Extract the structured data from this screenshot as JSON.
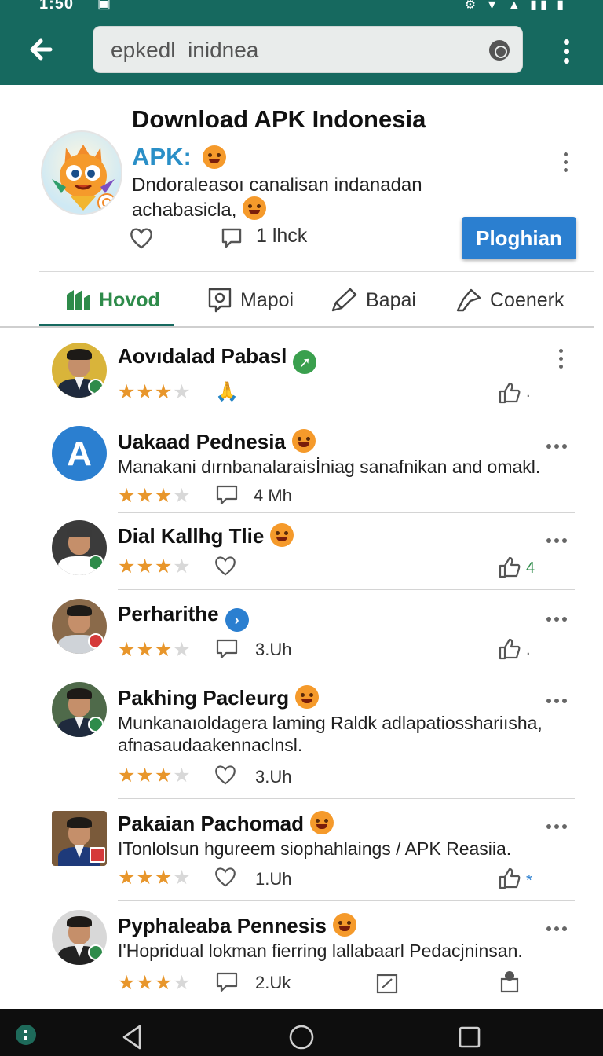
{
  "status_bar": {
    "time": "1:50",
    "notification_icon": "gallery-icon",
    "system_icons": "⚙ ▼ ▲ ▮▮ ▮"
  },
  "search": {
    "value": "epkedl  inidnea",
    "clear_icon": "clear-icon"
  },
  "app": {
    "title": "Download APK Indonesia",
    "apk_label": "APK:",
    "description": "Dndoraleasoı canalisan indanadan achabasicla,",
    "count": "1 lhck",
    "install_label": "Ploghian"
  },
  "tabs": [
    {
      "label": "Hovod",
      "icon": "home-icon",
      "active": true
    },
    {
      "label": "Mapoi",
      "icon": "image-icon",
      "active": false
    },
    {
      "label": "Bapai",
      "icon": "pen-icon",
      "active": false
    },
    {
      "label": "Coenerk",
      "icon": "share-arrow-icon",
      "active": false
    }
  ],
  "reviews": [
    {
      "name": "Aovıdalad Pabasl",
      "badge": "verified-green",
      "text": "",
      "rating": 3,
      "meta_icon": "hands-icon",
      "meta_count": "",
      "share_count": "."
    },
    {
      "name": "Uakaad Pednesia",
      "badge": "emoji",
      "text": "Manakani dırnbanalaraisİniag sanafnikan and omakl.",
      "rating": 3,
      "meta_icon": "comment-icon",
      "meta_count": "4 Mh",
      "share_count": ""
    },
    {
      "name": "Dial Kallhg Tlie",
      "badge": "emoji",
      "text": "",
      "rating": 3,
      "meta_icon": "heart-icon",
      "meta_count": "",
      "share_count": "4"
    },
    {
      "name": "Perharithe",
      "badge": "verified-blue",
      "text": "",
      "rating": 3,
      "meta_icon": "comment-icon",
      "meta_count": "3.Uh",
      "share_count": "."
    },
    {
      "name": "Pakhing Pacleurg",
      "badge": "emoji",
      "text": "Munkanaıoldagera laming Raldk adlapatiosshariısha, afnasaudaakennaclnsl.",
      "rating": 3,
      "meta_icon": "heart-icon",
      "meta_count": "3.Uh",
      "share_count": ""
    },
    {
      "name": "Pakaian Pachomad",
      "badge": "emoji",
      "text": "ITonlolsun hgureem siophahlaings / APK Reasiia.",
      "rating": 3,
      "meta_icon": "heart-icon",
      "meta_count": "1.Uh",
      "share_count": "*"
    },
    {
      "name": "Pyphaleaba Pennesis",
      "badge": "emoji",
      "text": "I'Hopridual lokman fierring lallabaarl Pedacjninsan.",
      "rating": 3,
      "meta_icon": "comment-icon",
      "meta_count": "2.Uk",
      "share_count": ""
    }
  ],
  "colors": {
    "app_bar": "#16695f",
    "install_button": "#2b7fd0",
    "star": "#e8962b",
    "active_tab": "#2e8b4a"
  },
  "nav": {
    "back": "back-triangle-icon",
    "home": "home-circle-icon",
    "recents": "recents-square-icon"
  }
}
